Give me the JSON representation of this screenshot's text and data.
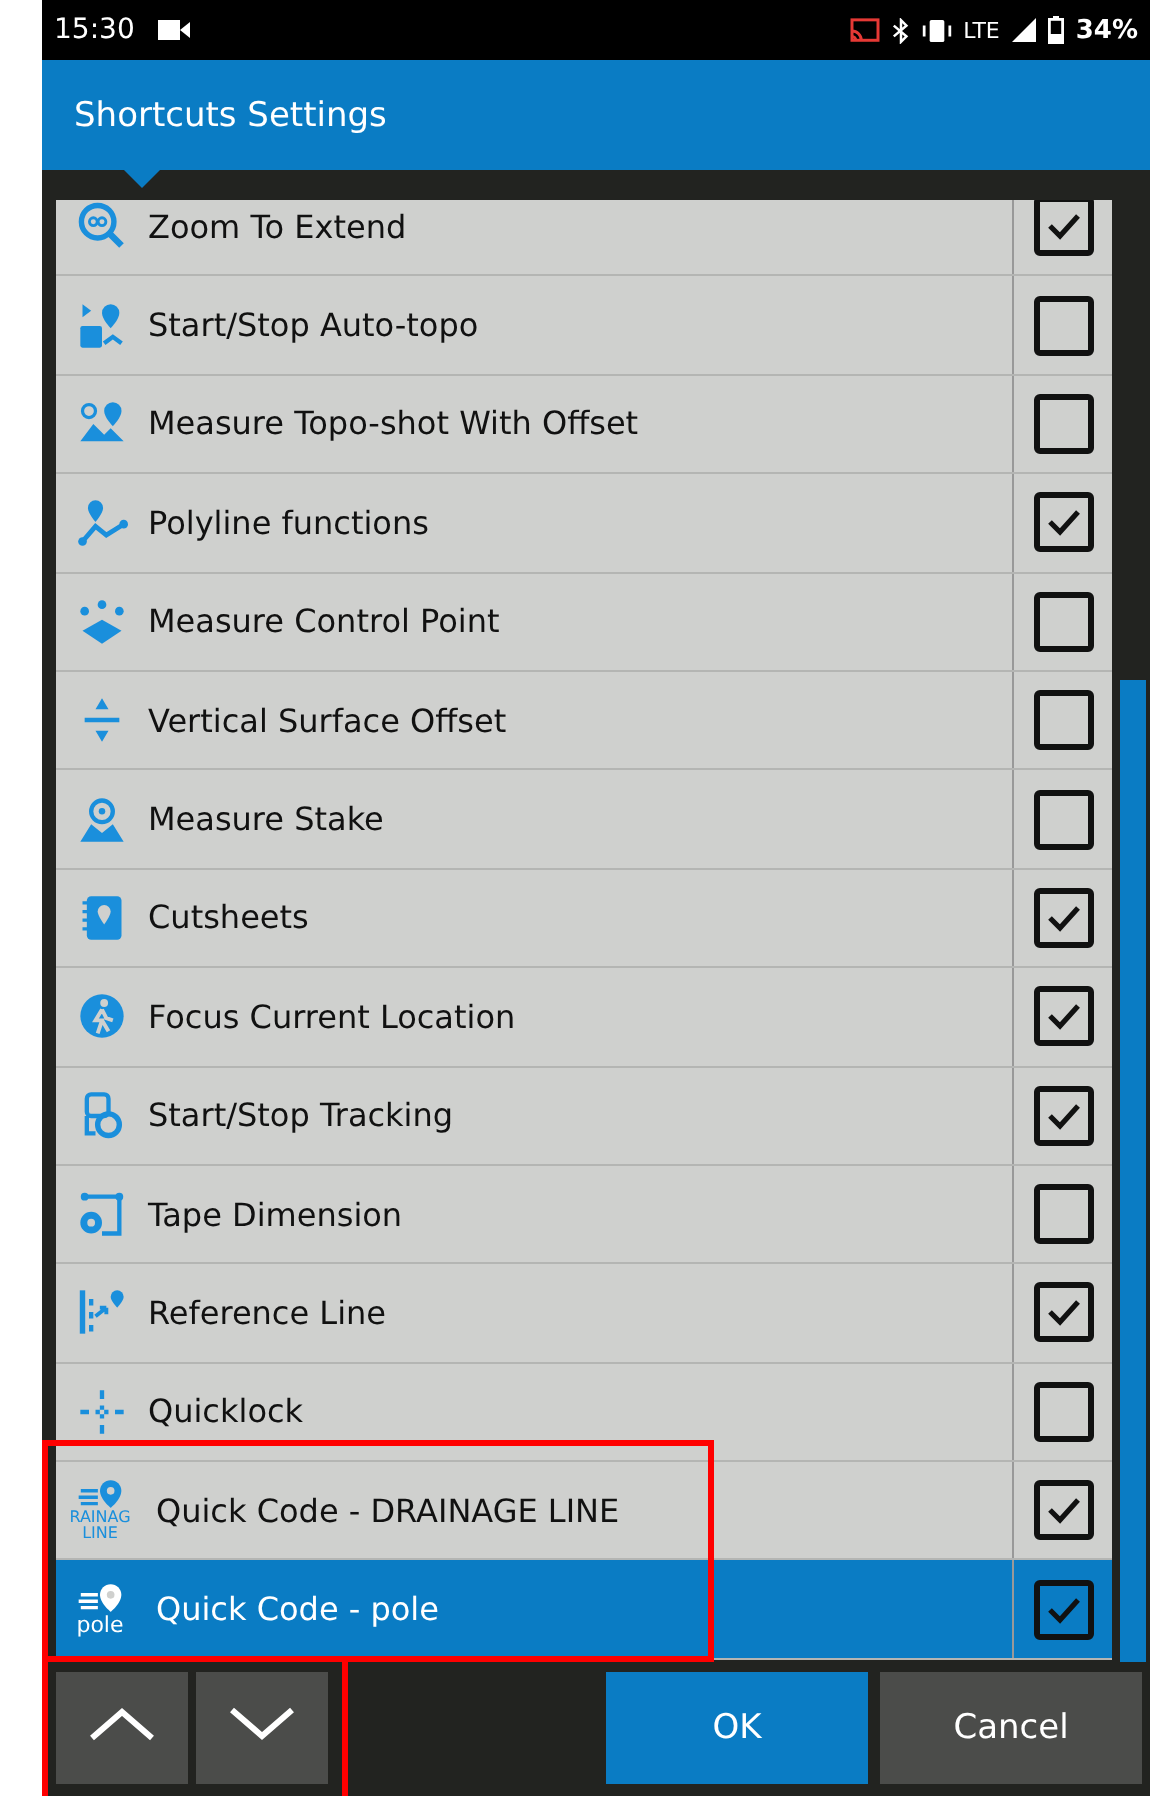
{
  "status_bar": {
    "time": "15:30",
    "network": "LTE",
    "battery": "34%"
  },
  "header": {
    "title": "Shortcuts Settings"
  },
  "shortcuts": [
    {
      "label": "Zoom To Extend",
      "checked": true,
      "selected": false
    },
    {
      "label": "Start/Stop Auto-topo",
      "checked": false,
      "selected": false
    },
    {
      "label": "Measure Topo-shot With Offset",
      "checked": false,
      "selected": false
    },
    {
      "label": "Polyline functions",
      "checked": true,
      "selected": false
    },
    {
      "label": "Measure Control Point",
      "checked": false,
      "selected": false
    },
    {
      "label": "Vertical Surface Offset",
      "checked": false,
      "selected": false
    },
    {
      "label": "Measure Stake",
      "checked": false,
      "selected": false
    },
    {
      "label": "Cutsheets",
      "checked": true,
      "selected": false
    },
    {
      "label": "Focus Current Location",
      "checked": true,
      "selected": false
    },
    {
      "label": "Start/Stop Tracking",
      "checked": true,
      "selected": false
    },
    {
      "label": "Tape Dimension",
      "checked": false,
      "selected": false
    },
    {
      "label": "Reference Line",
      "checked": true,
      "selected": false
    },
    {
      "label": "Quicklock",
      "checked": false,
      "selected": false
    },
    {
      "label": "Quick Code - DRAINAGE LINE",
      "checked": true,
      "selected": false,
      "icon_text": [
        "RAINAG",
        "LINE"
      ]
    },
    {
      "label": "Quick Code - pole",
      "checked": true,
      "selected": true,
      "icon_text": [
        "pole"
      ]
    }
  ],
  "buttons": {
    "ok": "OK",
    "cancel": "Cancel"
  }
}
